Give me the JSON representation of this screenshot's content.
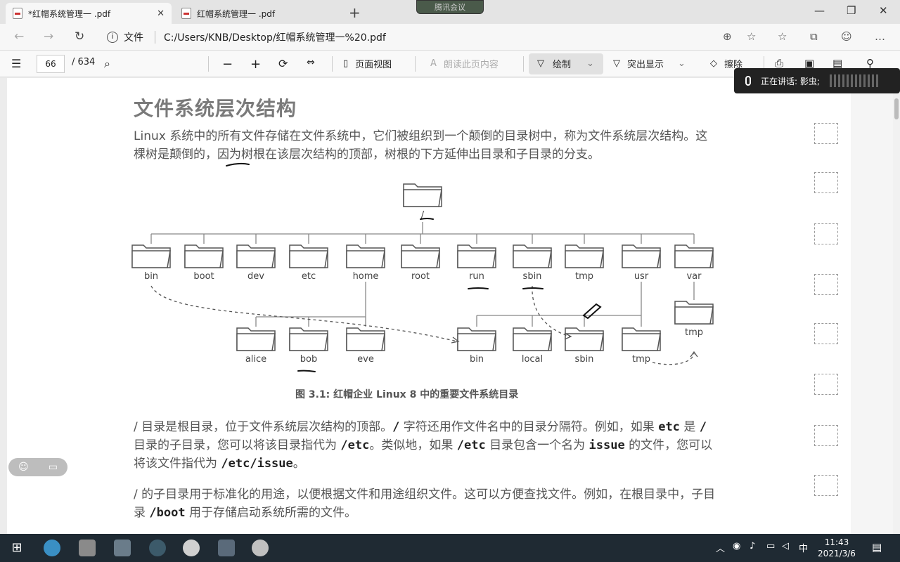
{
  "tabs": [
    {
      "label": "*红帽系统管理一 .pdf"
    },
    {
      "label": "红帽系统管理一 .pdf"
    }
  ],
  "meeting": "腾讯会议",
  "address": {
    "label": "文件",
    "url": "C:/Users/KNB/Desktop/红帽系统管理一%20.pdf"
  },
  "toolbar": {
    "page": "66",
    "total": "/ 634",
    "page_view": "页面视图",
    "read_aloud": "朗读此页内容",
    "draw": "绘制",
    "highlight": "突出显示",
    "erase": "擦除"
  },
  "speaking": "正在讲话: 影虫;",
  "doc": {
    "title": "文件系统层次结构",
    "intro": "Linux 系统中的所有文件存储在文件系统中，它们被组织到一个颠倒的目录树中，称为文件系统层次结构。这棵树是颠倒的，因为树根在该层次结构的顶部，树根的下方延伸出目录和子目录的分支。",
    "caption": "图 3.1: 红帽企业 Linux 8 中的重要文件系统目录",
    "p2a": "/ 目录是根目录，位于文件系统层次结构的顶部。",
    "p2b": "/",
    "p2c": " 字符还用作文件名中的目录分隔符。例如，如果 ",
    "p2d": "etc",
    "p2e": " 是 ",
    "p2f": "/",
    "p2g": " 目录的子目录，您可以将该目录指代为 ",
    "p2h": "/etc",
    "p2i": "。类似地，如果 ",
    "p2j": "/etc",
    "p2k": " 目录包含一个名为 ",
    "p2l": "issue",
    "p2m": " 的文件，您可以将该文件指代为 ",
    "p2n": "/etc/issue",
    "p2o": "。",
    "p3a": "/ 的子目录用于标准化的用途，以便根据文件和用途组织文件。这可以方便查找文件。例如，在根目录中，子目录 ",
    "p3b": "/boot",
    "p3c": " 用于存储启动系统所需的文件。"
  },
  "diagram": {
    "root": "/",
    "top": [
      "bin",
      "boot",
      "dev",
      "etc",
      "home",
      "root",
      "run",
      "sbin",
      "tmp",
      "usr",
      "var"
    ],
    "home_children": [
      "alice",
      "bob",
      "eve"
    ],
    "usr_children": [
      "bin",
      "local",
      "sbin",
      "tmp"
    ],
    "var_children": [
      "tmp"
    ]
  },
  "clock": {
    "time": "11:43",
    "date": "2021/3/6"
  },
  "ime": "中"
}
